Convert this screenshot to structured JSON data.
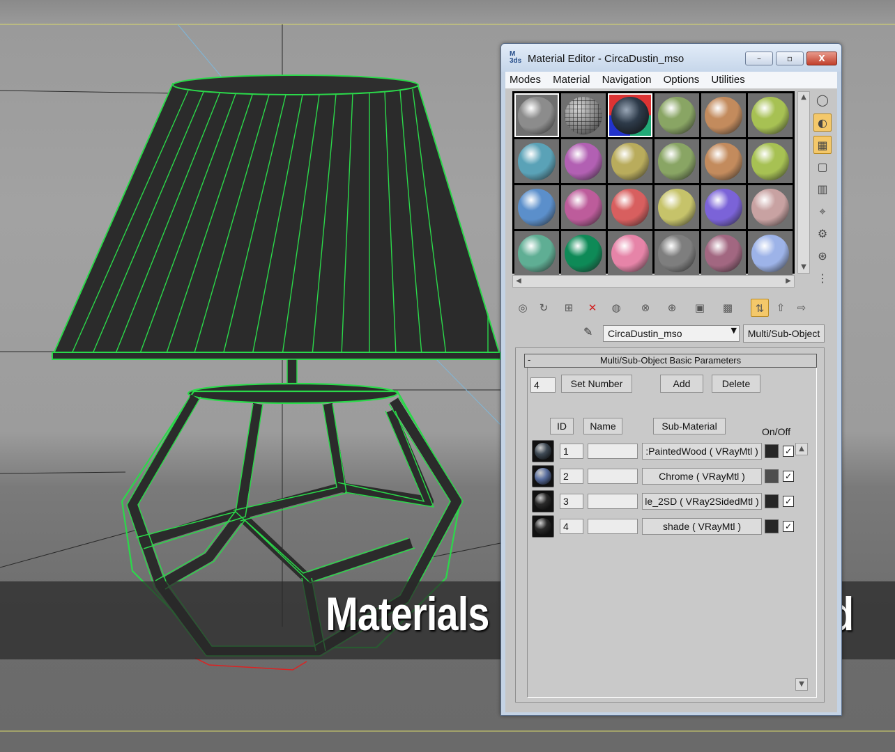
{
  "window": {
    "logo": "M\n3ds",
    "title": "Material Editor - CircaDustin_mso",
    "min": "–",
    "max": "▫",
    "close": "X"
  },
  "menu": [
    "Modes",
    "Material",
    "Navigation",
    "Options",
    "Utilities"
  ],
  "slots": [
    {
      "color": "#8c8c8c",
      "active": true
    },
    {
      "color": "#7a7a7a",
      "active": false,
      "pattern": "wire"
    },
    {
      "color": "#3a3a3a",
      "active": true,
      "pattern": "chrome"
    },
    {
      "color": "#89a564",
      "active": false
    },
    {
      "color": "#c38b5d",
      "active": false
    },
    {
      "color": "#a7c153",
      "active": false
    },
    {
      "color": "#5aa2b7",
      "active": false
    },
    {
      "color": "#b260b3",
      "active": false
    },
    {
      "color": "#b9ac5c",
      "active": false
    },
    {
      "color": "#89a564",
      "active": false
    },
    {
      "color": "#c38b5d",
      "active": false
    },
    {
      "color": "#a7c153",
      "active": false
    },
    {
      "color": "#5b8fcb",
      "active": false
    },
    {
      "color": "#bd5c9b",
      "active": false
    },
    {
      "color": "#d85f5f",
      "active": false
    },
    {
      "color": "#c6c36a",
      "active": false
    },
    {
      "color": "#7b63d8",
      "active": false
    },
    {
      "color": "#c8a2a2",
      "active": false
    },
    {
      "color": "#5fae94",
      "active": false
    },
    {
      "color": "#0e8a57",
      "active": false
    },
    {
      "color": "#e684a8",
      "active": false
    },
    {
      "color": "#7e7e7e",
      "active": false
    },
    {
      "color": "#a26781",
      "active": false
    },
    {
      "color": "#9db3e8",
      "active": false
    }
  ],
  "side_tools": [
    "sample-type-icon",
    "backlight-icon",
    "background-icon",
    "uv-tiling-icon",
    "video-color-check-icon",
    "make-preview-icon",
    "options-icon",
    "select-by-material-icon",
    "material-map-navigator-icon"
  ],
  "bottom_tools": [
    "get-material-icon",
    "put-to-scene-icon",
    "assign-to-selection-icon",
    "reset-map-icon",
    "make-copy-icon",
    "make-unique-icon",
    "put-to-library-icon",
    "material-id-channel-icon",
    "show-map-icon",
    "show-end-result-icon",
    "go-to-parent-icon",
    "go-forward-icon"
  ],
  "material": {
    "name": "CircaDustin_mso",
    "type": "Multi/Sub-Object"
  },
  "rollout": {
    "minus": "-",
    "title": "Multi/Sub-Object Basic Parameters",
    "count": "4",
    "set_number": "Set Number",
    "add": "Add",
    "delete": "Delete",
    "col_id": "ID",
    "col_name": "Name",
    "col_submaterial": "Sub-Material",
    "col_onoff": "On/Off",
    "rows": [
      {
        "id": "1",
        "name": "",
        "sub": ":PaintedWood  ( VRayMtl )",
        "swatch": "#262626",
        "on": "✓",
        "thumb": "#3f4a55"
      },
      {
        "id": "2",
        "name": "",
        "sub": "Chrome  ( VRayMtl )",
        "swatch": "#4e4e4e",
        "on": "✓",
        "thumb": "#5a6fa0"
      },
      {
        "id": "3",
        "name": "",
        "sub": "le_2SD  ( VRay2SidedMtl )",
        "swatch": "#262626",
        "on": "✓",
        "thumb": "#2a2a2a"
      },
      {
        "id": "4",
        "name": "",
        "sub": "shade  ( VRayMtl )",
        "swatch": "#262626",
        "on": "✓",
        "thumb": "#2a2a2a"
      }
    ]
  },
  "caption": "Materials & textures provided",
  "colors": {
    "wire": "#2bd94a",
    "mesh": "#2b2b2b"
  }
}
